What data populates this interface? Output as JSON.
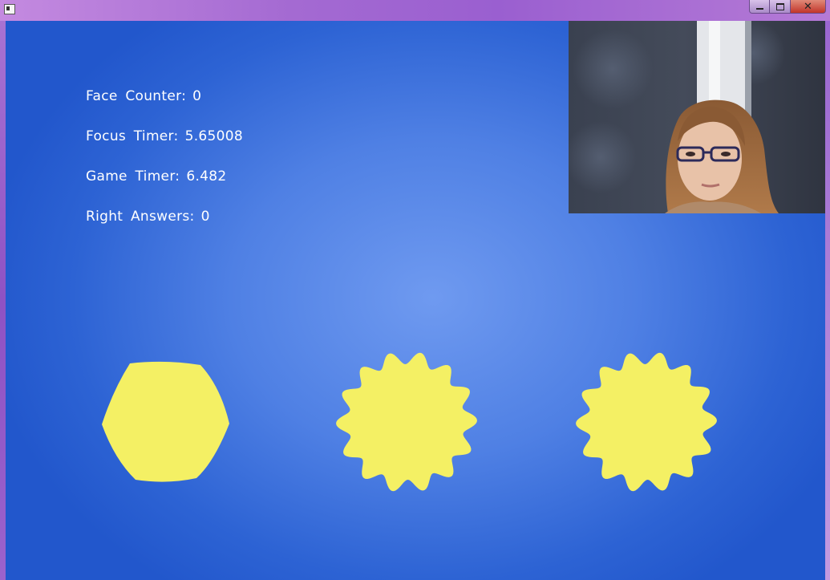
{
  "window": {
    "buttons": [
      "minimize",
      "maximize",
      "close"
    ]
  },
  "hud": {
    "face_counter_label": "Face Counter:",
    "face_counter_value": "0",
    "focus_timer_label": "Focus Timer:",
    "focus_timer_value": "5.65008",
    "game_timer_label": "Game Timer:",
    "game_timer_value": "6.482",
    "right_answers_label": "Right Answers:",
    "right_answers_value": "0"
  },
  "shapes": [
    {
      "kind": "hexagon",
      "color": "#f4f064"
    },
    {
      "kind": "wavy-circle",
      "color": "#f4f064"
    },
    {
      "kind": "wavy-circle",
      "color": "#f4f064"
    }
  ],
  "colors": {
    "background_center": "#6f9af0",
    "background_edge": "#2257cc",
    "shape_yellow": "#f4f064",
    "text": "#ffffff"
  }
}
